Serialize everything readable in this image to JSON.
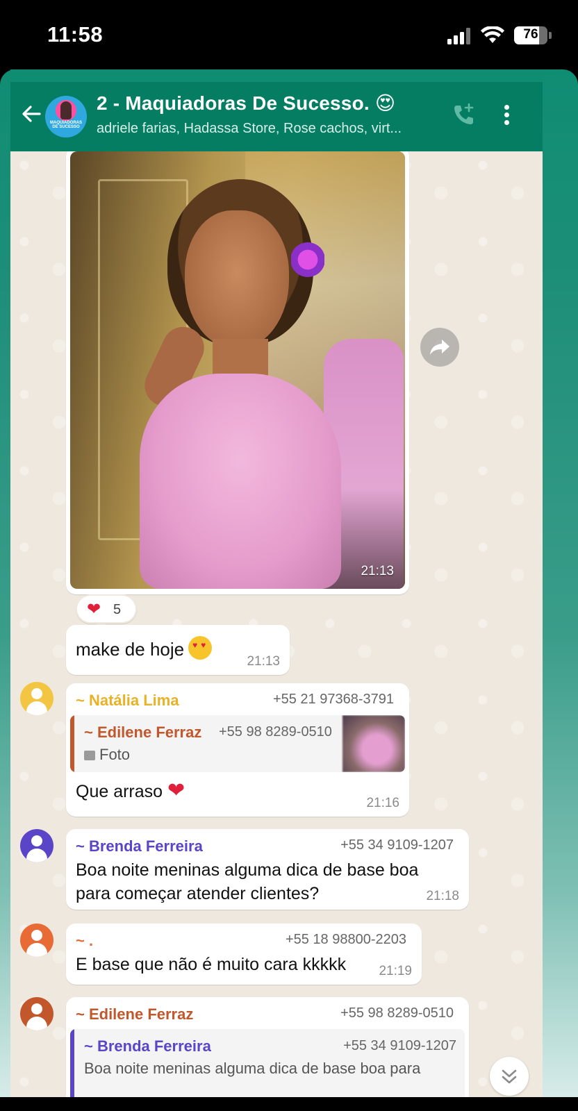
{
  "status_bar": {
    "time": "11:58",
    "battery": "76",
    "battery_level": 0.76
  },
  "header": {
    "group_name": "2 - Maquiadoras De Sucesso. 😍",
    "participants": "adriele farias, Hadassa Store, Rose cachos, virt...",
    "avatar_text": "MAQUIADORAS DE SUCESSO"
  },
  "messages": {
    "photo": {
      "time": "21:13"
    },
    "reaction": {
      "emoji": "❤",
      "count": "5"
    },
    "caption": {
      "text": "make de hoje",
      "time": "21:13"
    },
    "natalia": {
      "sender": "~ Natália Lima",
      "phone": "+55 21 97368-3791",
      "quote_sender": "~ Edilene Ferraz",
      "quote_phone": "+55 98 8289-0510",
      "quote_text": "Foto",
      "text": "Que arraso",
      "emoji": "❤",
      "time": "21:16"
    },
    "brenda": {
      "sender": "~ Brenda Ferreira",
      "phone": "+55 34 9109-1207",
      "text_line1": "Boa noite meninas alguma dica de base boa",
      "text_line2": "para começar atender clientes?",
      "time": "21:18"
    },
    "dot": {
      "sender": "~ .",
      "phone": "+55 18 98800-2203",
      "text": "E base que não é muito cara kkkkk",
      "time": "21:19"
    },
    "edilene": {
      "sender": "~ Edilene Ferraz",
      "phone": "+55 98 8289-0510",
      "quote_sender": "~ Brenda Ferreira",
      "quote_phone": "+55 34 9109-1207",
      "quote_text": "Boa noite meninas alguma dica de base boa para"
    }
  },
  "colors": {
    "header": "#047d63",
    "natalia": "#e8b227",
    "edilene": "#c2572c",
    "brenda": "#5a45c9",
    "dot": "#e86a35"
  }
}
